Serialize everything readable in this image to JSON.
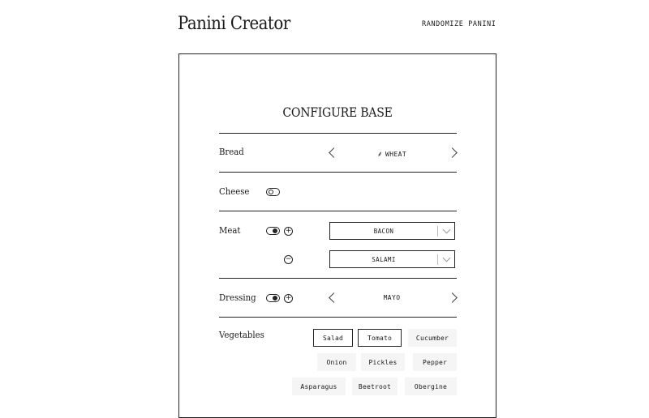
{
  "header": {
    "title": "Panini Creator",
    "randomize_label": "RANDOMIZE PANINI"
  },
  "base": {
    "section_title": "CONFIGURE BASE",
    "bread": {
      "label": "Bread",
      "value": "WHEAT",
      "icon": "wheat-icon"
    },
    "cheese": {
      "label": "Cheese",
      "enabled": false
    },
    "meat": {
      "label": "Meat",
      "enabled": true,
      "items": [
        "BACON",
        "SALAMI"
      ]
    },
    "dressing": {
      "label": "Dressing",
      "enabled": true,
      "value": "MAYO"
    },
    "vegetables": {
      "label": "Vegetables",
      "items": [
        {
          "label": "Salad",
          "selected": true
        },
        {
          "label": "Tomato",
          "selected": true
        },
        {
          "label": "Cucumber",
          "selected": false
        },
        {
          "label": "Onion",
          "selected": false
        },
        {
          "label": "Pickles",
          "selected": false
        },
        {
          "label": "Pepper",
          "selected": false
        },
        {
          "label": "Asparagus",
          "selected": false
        },
        {
          "label": "Beetroot",
          "selected": false
        },
        {
          "label": "Obergine",
          "selected": false
        }
      ]
    }
  }
}
